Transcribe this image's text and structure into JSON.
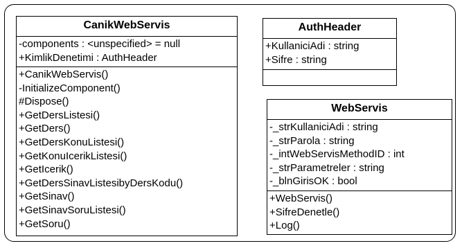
{
  "classes": [
    {
      "name": "CanikWebServis",
      "attributes": [
        "-components : <unspecified> = null",
        "+KimlikDenetimi : AuthHeader"
      ],
      "methods": [
        "+CanikWebServis()",
        "-InitializeComponent()",
        "#Dispose()",
        "+GetDersListesi()",
        "+GetDers()",
        "+GetDersKonuListesi()",
        "+GetKonuIcerikListesi()",
        "+GetIcerik()",
        "+GetDersSinavListesibyDersKodu()",
        "+GetSinav()",
        "+GetSinavSoruListesi()",
        "+GetSoru()"
      ]
    },
    {
      "name": "AuthHeader",
      "attributes": [
        "+KullaniciAdi : string",
        "+Sifre : string"
      ],
      "methods": []
    },
    {
      "name": "WebServis",
      "attributes": [
        "-_strKullaniciAdi : string",
        "-_strParola : string",
        "-_intWebServisMethodID : int",
        "-_strParametreler : string",
        "-_blnGirisOK : bool"
      ],
      "methods": [
        "+WebServis()",
        "+SifreDenetle()",
        "+Log()"
      ]
    }
  ]
}
